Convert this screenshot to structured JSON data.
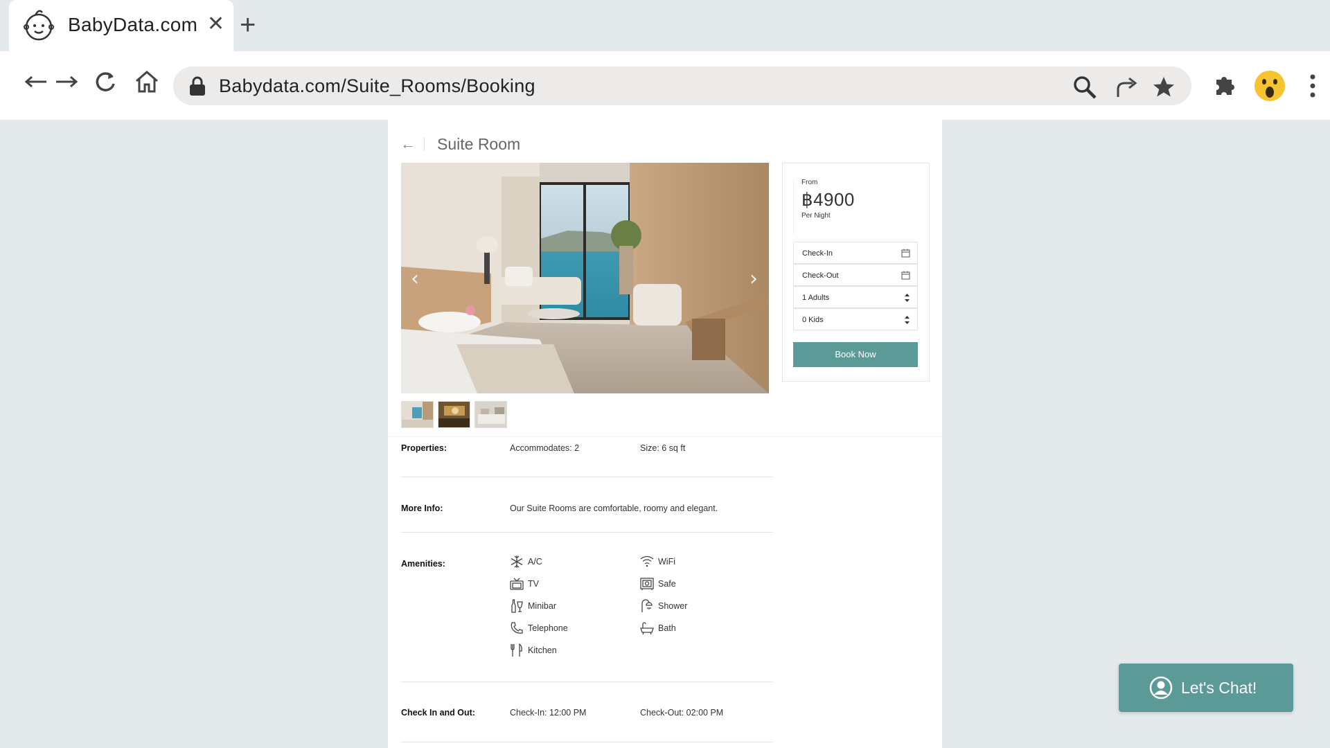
{
  "browser": {
    "tab_title": "BabyData.com",
    "tab_close": "✕",
    "new_tab": "+",
    "url": "Babydata.com/Suite_Rooms/Booking",
    "icons": [
      "back-icon",
      "forward-icon",
      "reload-icon",
      "home-icon",
      "lock-icon",
      "search-icon",
      "share-icon",
      "bookmark-star-icon",
      "extensions-icon",
      "profile-avatar-icon",
      "menu-icon"
    ]
  },
  "page": {
    "back_arrow": "←",
    "title": "Suite Room",
    "carousel": {
      "prev": "‹",
      "next": "›",
      "thumbnail_count": 3
    },
    "booking": {
      "from_label": "From",
      "price": "฿4900",
      "per_night": "Per Night",
      "check_in": "Check-In",
      "check_out": "Check-Out",
      "adults": "1 Adults",
      "kids": "0 Kids",
      "book_button": "Book Now"
    },
    "properties": {
      "label": "Properties:",
      "accommodates": "Accommodates: 2",
      "size": "Size: 6 sq ft"
    },
    "more_info": {
      "label": "More Info:",
      "text": "Our Suite Rooms are comfortable, roomy and elegant."
    },
    "amenities": {
      "label": "Amenities:",
      "left": [
        "A/C",
        "TV",
        "Minibar",
        "Telephone",
        "Kitchen"
      ],
      "right": [
        "WiFi",
        "Safe",
        "Shower",
        "Bath"
      ]
    },
    "check_times": {
      "label": "Check In and Out:",
      "check_in": "Check-In: 12:00 PM",
      "check_out": "Check-Out: 02:00 PM"
    }
  },
  "chat": {
    "label": "Let's Chat!"
  },
  "colors": {
    "accent": "#5c9a97",
    "background": "#e4e9ec"
  }
}
